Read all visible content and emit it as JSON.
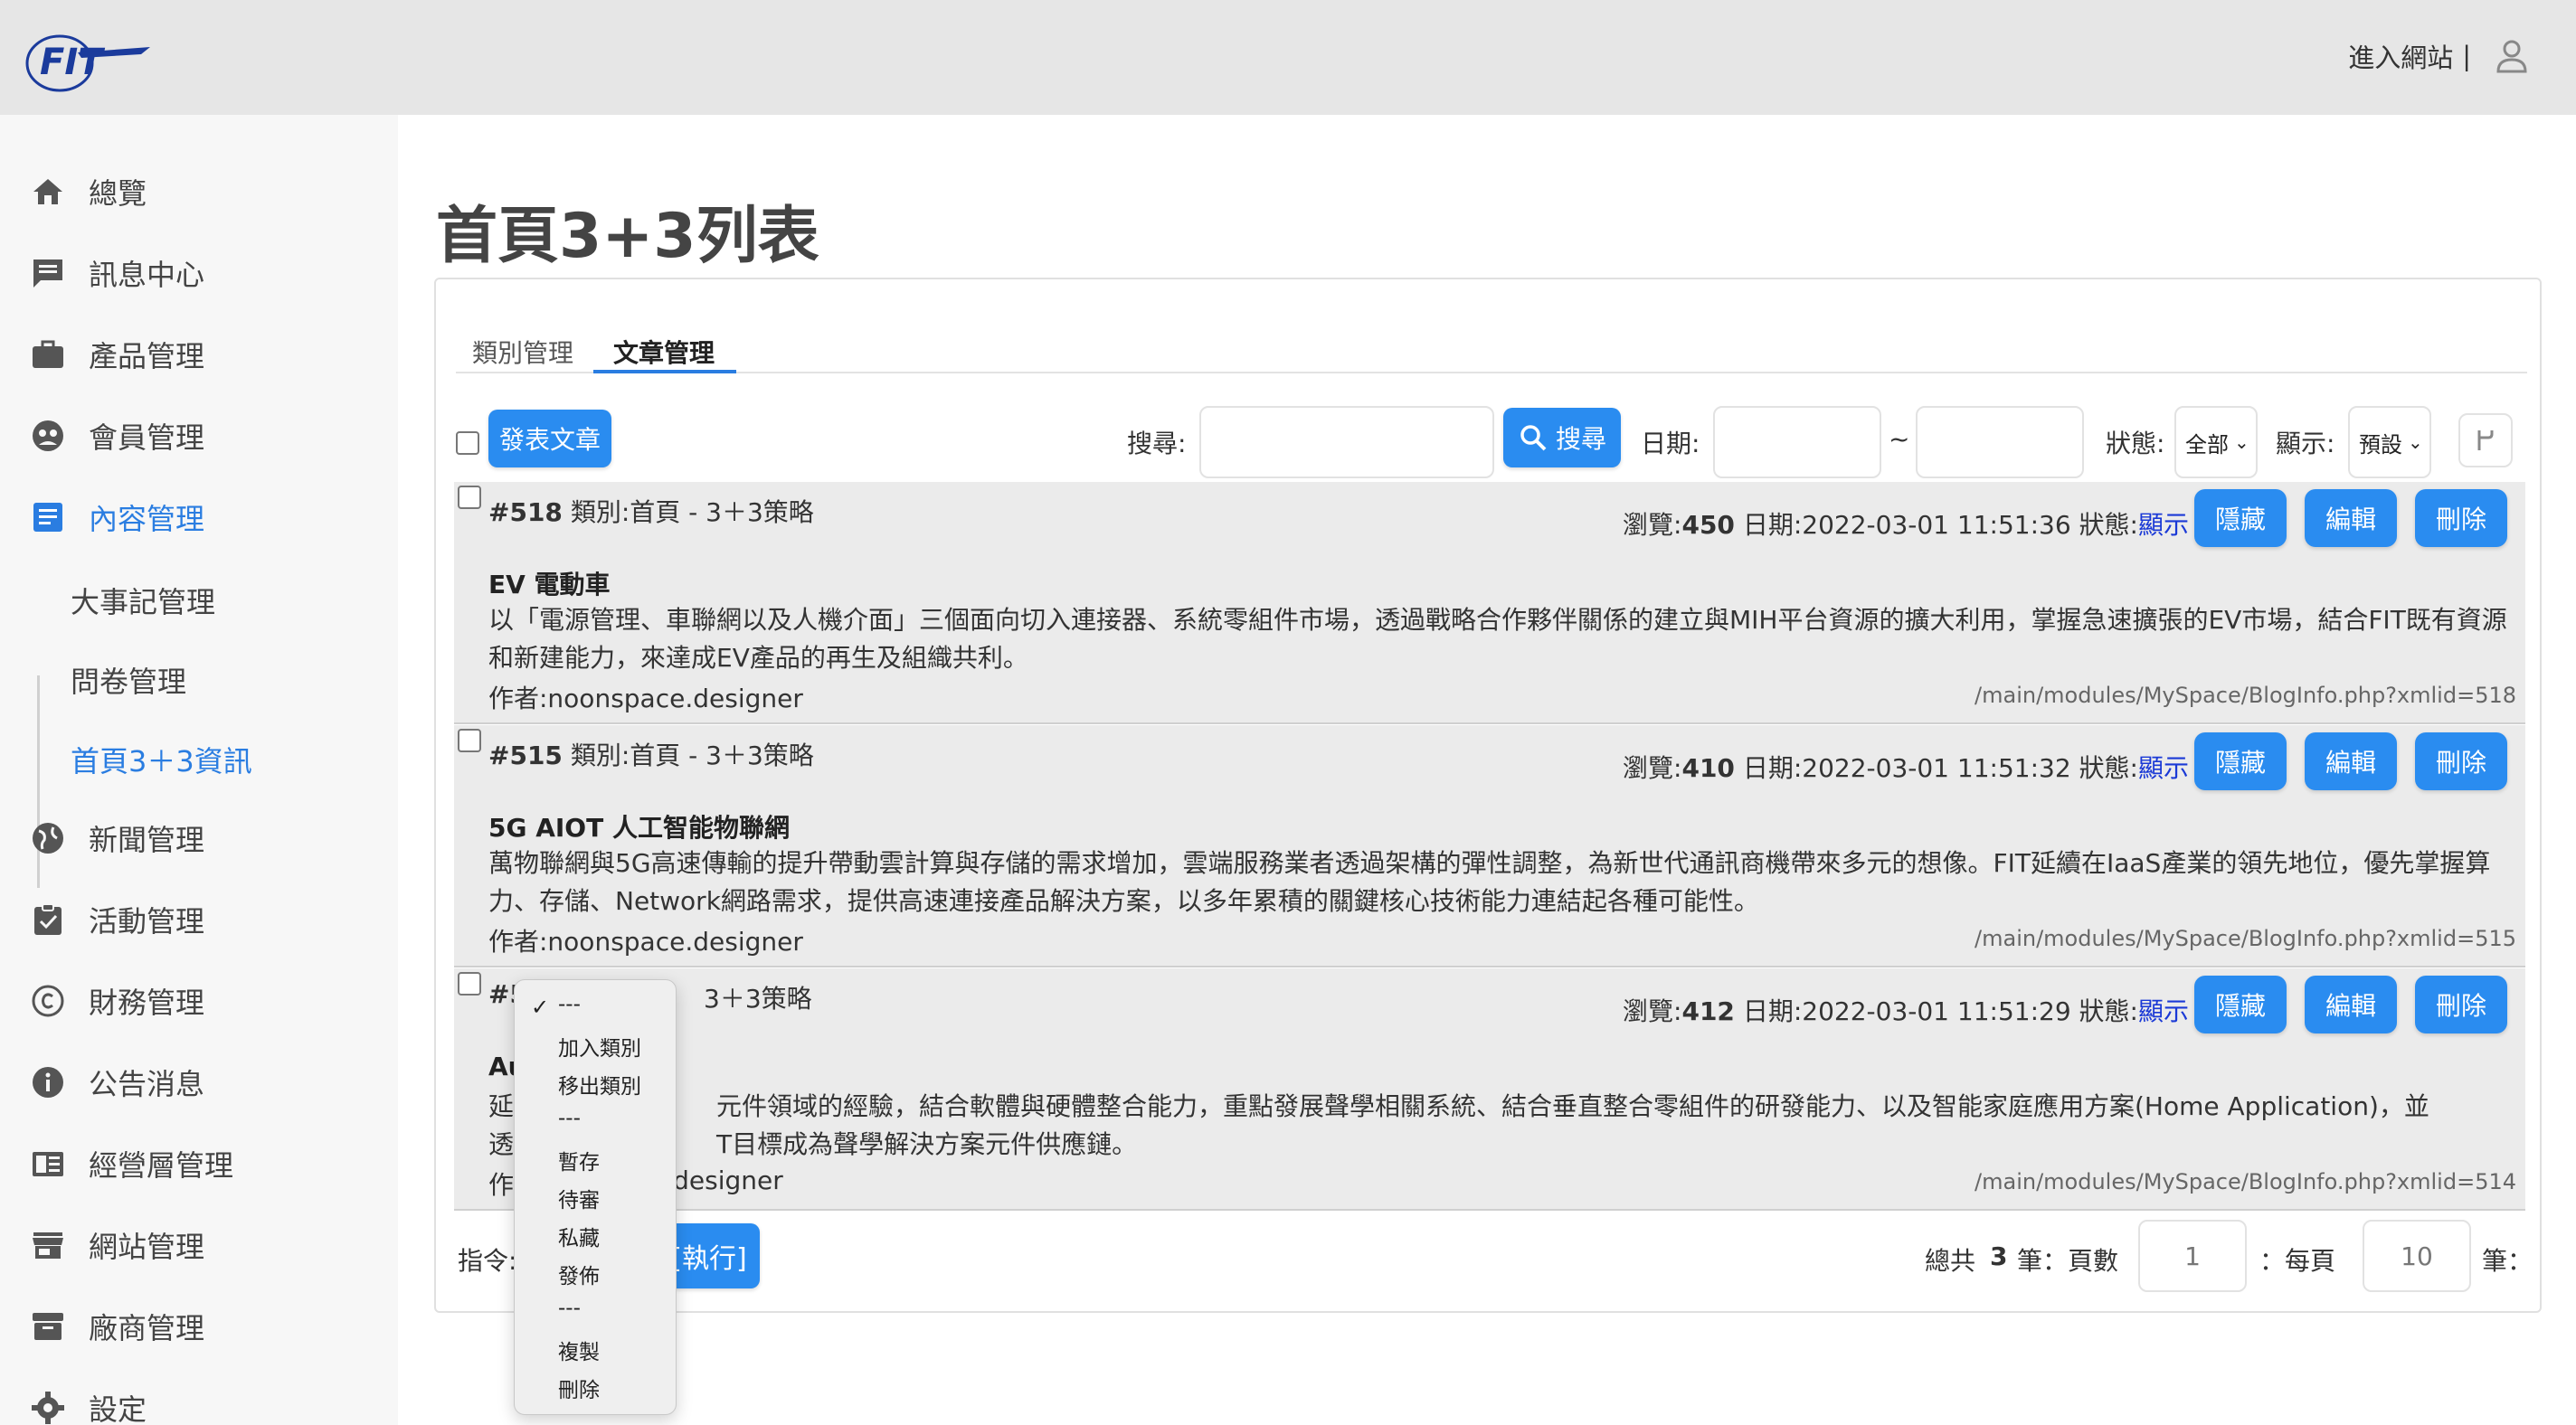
{
  "header": {
    "enter_site": "進入網站",
    "separator": "|"
  },
  "sidebar": {
    "items": [
      {
        "label": "總覽"
      },
      {
        "label": "訊息中心"
      },
      {
        "label": "產品管理"
      },
      {
        "label": "會員管理"
      },
      {
        "label": "內容管理"
      },
      {
        "label": "新聞管理"
      },
      {
        "label": "活動管理"
      },
      {
        "label": "財務管理"
      },
      {
        "label": "公告消息"
      },
      {
        "label": "經營層管理"
      },
      {
        "label": "網站管理"
      },
      {
        "label": "廠商管理"
      },
      {
        "label": "設定"
      }
    ],
    "subitems": [
      {
        "label": "大事記管理"
      },
      {
        "label": "問卷管理"
      },
      {
        "label": "首頁3＋3資訊"
      }
    ],
    "active_color": "#2a7de1"
  },
  "main": {
    "title": "首頁3+3列表",
    "tabs": [
      {
        "label": "類別管理"
      },
      {
        "label": "文章管理"
      }
    ],
    "toolbar": {
      "post_button": "發表文章",
      "search_label": "搜尋:",
      "search_button": "搜尋",
      "date_label": "日期:",
      "date_sep": "~",
      "status_label": "狀態:",
      "status_value": "全部",
      "display_label": "顯示:",
      "display_value": "預設"
    },
    "posts": [
      {
        "id": "#518",
        "category": "類別:首頁 - 3＋3策略",
        "views_label": "瀏覽:",
        "views": "450",
        "date": "日期:2022-03-01 11:51:36",
        "status_label": "狀態:",
        "status": "顯示",
        "title": "EV 電動車",
        "desc": "以「電源管理、車聯網以及人機介面」三個面向切入連接器、系統零組件市場，透過戰略合作夥伴關係的建立與MIH平台資源的擴大利用，掌握急速擴張的EV市場，結合FIT既有資源和新建能力，來達成EV產品的再生及組織共利。",
        "author": "作者:noonspace.designer",
        "url": "/main/modules/MySpace/BlogInfo.php?xmlid=518"
      },
      {
        "id": "#515",
        "category": "類別:首頁 - 3＋3策略",
        "views_label": "瀏覽:",
        "views": "410",
        "date": "日期:2022-03-01 11:51:32",
        "status_label": "狀態:",
        "status": "顯示",
        "title": "5G AIOT 人工智能物聯網",
        "desc": "萬物聯網與5G高速傳輸的提升帶動雲計算與存儲的需求增加，雲端服務業者透過架構的彈性調整，為新世代通訊商機帶來多元的想像。FIT延續在IaaS產業的領先地位，優先掌握算力、存儲、Network網路需求，提供高速連接產品解決方案，以多年累積的關鍵核心技術能力連結起各種可能性。",
        "author": "作者:noonspace.designer",
        "url": "/main/modules/MySpace/BlogInfo.php?xmlid=515"
      },
      {
        "id": "#5",
        "category": "3＋3策略",
        "views_label": "瀏覽:",
        "views": "412",
        "date": "日期:2022-03-01 11:51:29",
        "status_label": "狀態:",
        "status": "顯示",
        "title": "Au",
        "desc_line1_a": "延",
        "desc_line1_b": "元件領域的經驗，結合軟體與硬體整合能力，重點發展聲學相關系統、結合垂直整合零組件的研發能力、以及智能家庭應用方案(Home Application)，並",
        "desc_line2_a": "透",
        "desc_line2_b": "T目標成為聲學解決方案元件供應鏈。",
        "author_a": "作",
        "author_b": "e.designer",
        "url": "/main/modules/MySpace/BlogInfo.php?xmlid=514"
      }
    ],
    "row_buttons": {
      "hide": "隱藏",
      "edit": "編輯",
      "delete": "刪除"
    },
    "footer": {
      "command_label": "指令:",
      "execute": "[執行]",
      "total_prefix": "總共",
      "total_count": "3",
      "total_suffix": "筆：頁數",
      "page_value": "1",
      "per_page_label": "：每頁",
      "per_page_value": "10",
      "per_page_suffix": "筆："
    },
    "dropdown": {
      "selected_mark": "✓",
      "options": [
        "---",
        "加入類別",
        "移出類別",
        "---",
        "暫存",
        "待審",
        "私藏",
        "發佈",
        "---",
        "複製",
        "刪除"
      ]
    }
  },
  "colors": {
    "accent": "#2a8cf0",
    "status_link": "#1a39d6",
    "topbar_bg": "#e6e6e6",
    "sidebar_bg": "#f7f7f7",
    "row_bg": "#ebebeb"
  }
}
